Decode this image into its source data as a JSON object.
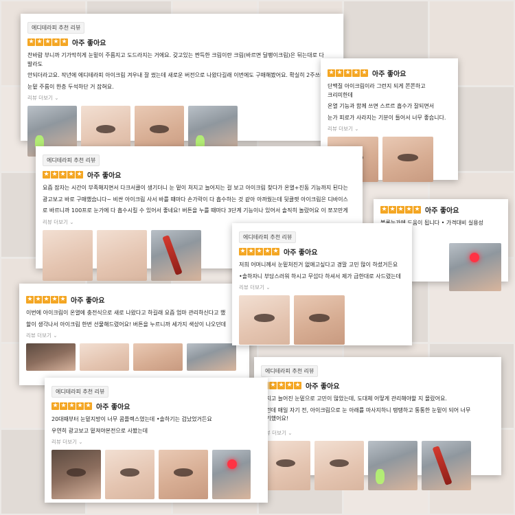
{
  "theme": {
    "star_color": "#f4a623",
    "accent_red": "#d43a2f"
  },
  "reviews": [
    {
      "badge": "에디테라피 추천 리뷰",
      "rating_label": "아주 좋아요",
      "text_lines": [
        "찬바람 부니까 기가막히게 눈밑이 주름지고 도드라지는 거에요. 갖고있는 짠득한 크림이란 크림(바르면 달팽이크림)은 뒤는대로 다 발라도",
        "안되더라고요. 작년에 에디테라피 아이크림 겨우내 잘 썼는데 새로운 버전으로 나왔다길래 이번에도 구매해봤어요. 확실히 2주쓰니까",
        "눈밑 주름이 한층 두석하단 거 잡혀요."
      ],
      "more": "리뷰 더보기 ⌄",
      "thumbs": [
        "device",
        "pale",
        "normal",
        "device"
      ]
    },
    {
      "badge": "",
      "rating_label": "아주 좋아요",
      "text_lines": [
        "단백질 아이크림이라 그런지 되게 쫀쫀하고 크리미한데",
        "온열 기능과 함께 쓰면 스르르 흡수가 잘되면서",
        "눈가 피로가 사라지는 기분이 들어서 너무 좋습니다."
      ],
      "more": "리뷰 더보기 ⌄",
      "thumbs": [
        "normal",
        "normal"
      ]
    },
    {
      "badge": "에디테라피 추천 리뷰",
      "rating_label": "아주 좋아요",
      "text_lines": [
        "요즘 잠자는 시간이 부족해지면서 다크서클이 생기더니 눈 밑이 처지고 늘어지는 걸 보고 아이크림 찾다가 온열+진동 기능까지 된다는",
        "광고보고 바로 구매했습니다~ 비싼 아이크림 사서 바를 때마다 손가락이 다 흡수하는 것 같아 아까웠는데 뒷클렛 아이크림은 디바이스",
        "로 바르니까 100프로 눈가에 다 흡수시킬 수 있어서 좋네요! 버튼을 누를 때마다 3단계 기능이나 있어서 솔직히 놀랐어요 이 쪼꼬만게"
      ],
      "more": "리뷰 더보기 ⌄",
      "thumbs": [
        "pale",
        "pale",
        "device"
      ]
    },
    {
      "badge": "",
      "rating_label": "아주 좋아요",
      "text_lines": [
        "볼록눈가에 도움이 됩니다 • 가격대비 실용성 짱입니다"
      ],
      "more": "",
      "thumbs": []
    },
    {
      "badge": "에디테라피 추천 리뷰",
      "rating_label": "아주 좋아요",
      "text_lines": [
        "저희 어머니께서 눈밑처진거 없애고싶다고 경말 고민 많이 하셨거든요",
        "•솔하자니 부담스러워 하시고 무섭다 하셔서 제가 급한대로 사드렸는데"
      ],
      "more": "리뷰 더보기 ⌄",
      "thumbs": [
        "pale",
        "normal"
      ]
    },
    {
      "badge": "",
      "rating_label": "아주 좋아요",
      "text_lines": [
        "이번에 아이크림이 온열에 충전식으로 새로 나왔다고 하길래 요즘 엄마 관리하신다고 했",
        "",
        "할이 생각나서 아이크림 한번 선물해드렸어요! 버튼을 누르니까 세가지 색상이 나오던데"
      ],
      "more": "리뷰 더보기 ⌄",
      "thumbs": [
        "dark",
        "pale",
        "normal",
        "device"
      ]
    },
    {
      "badge": "에디테라피 추천 리뷰",
      "rating_label": "아주 좋아요",
      "text_lines": [
        "처지고 늘어진 눈밑으로 고민이 많았는데, 도대체 어떻게 관리해야할 지 몰랐어요.",
        "그런데 매일 자기 전, 아이크림으로 눈 아래를 마사지하니 탱탱하고 통통한 눈밑이 되어 너무 신기했어요!"
      ],
      "more": "리뷰 더보기 ⌄",
      "thumbs": [
        "pale",
        "pale",
        "device",
        "device"
      ]
    },
    {
      "badge": "에디테라피 추천 리뷰",
      "rating_label": "아주 좋아요",
      "text_lines": [
        "20대때부터 눈밑지방이 너무 콤플렉스였는데 •솔하기는 겁났었거든요",
        "",
        "우연히 광고보고 밑져야본전으로 사봤는데"
      ],
      "more": "리뷰 더보기 ⌄",
      "thumbs": [
        "dark",
        "pale",
        "normal",
        "device"
      ]
    }
  ]
}
